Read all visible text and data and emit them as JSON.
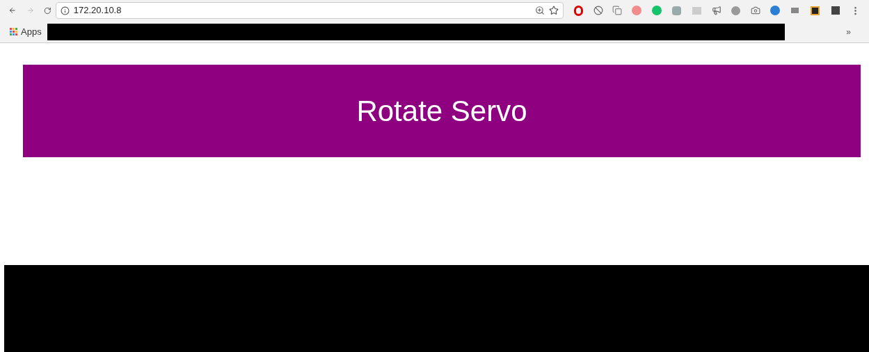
{
  "browser": {
    "url": "172.20.10.8",
    "apps_label": "Apps",
    "overflow": "»"
  },
  "page": {
    "title": "Rotate Servo"
  }
}
